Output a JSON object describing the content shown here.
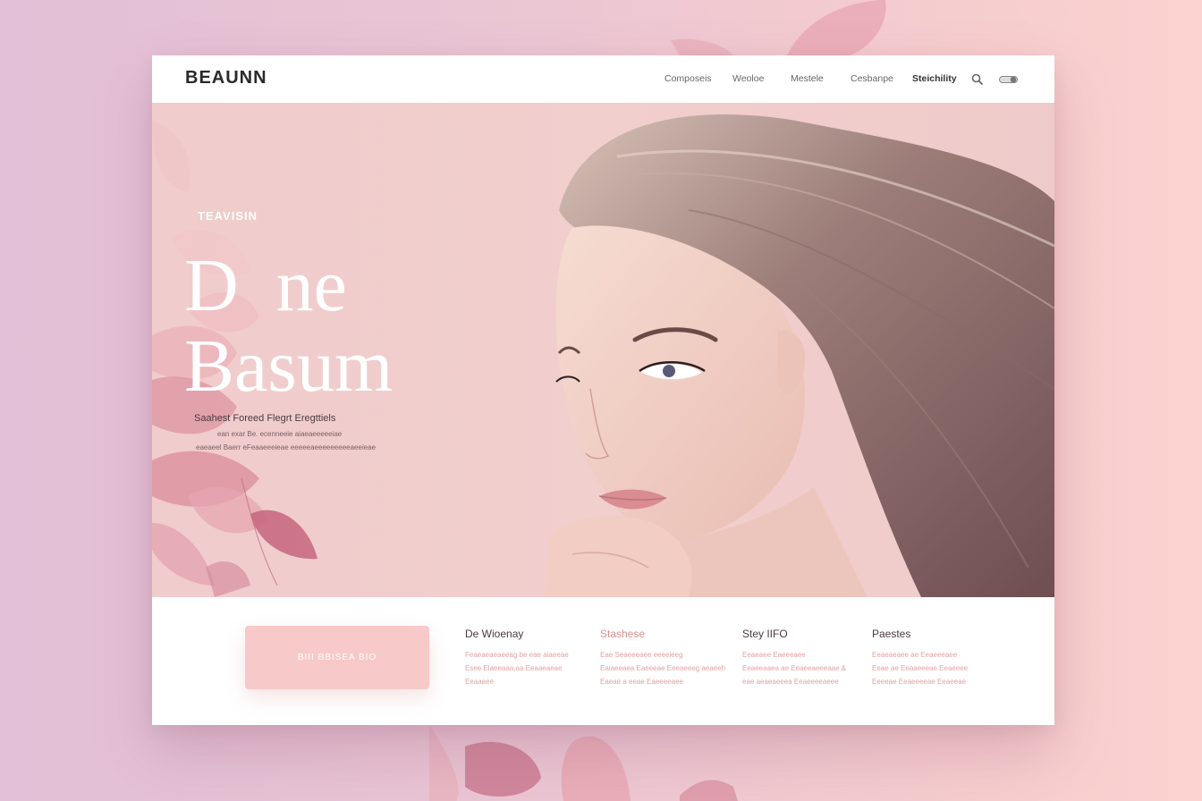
{
  "header": {
    "brand": "BEAUNN",
    "nav": [
      "Composeis",
      "Weoloe",
      "Mestele",
      "Cesbanpe",
      "Steichility"
    ],
    "active_nav": "Steichility",
    "icons": [
      "search-icon",
      "toggle-icon"
    ]
  },
  "hero": {
    "eyebrow": "TEAVISIN",
    "headline": "D  ne\nBasum",
    "subtitle": "Saahest Foreed Flegrt Eregttiels",
    "lines": [
      "ean exar Be. ecenneeie aiaeaeeeeeiae",
      "eaeaeel Baerr eFeaaeeeieae eeeeeaeeeeeeeeeaeeieae"
    ]
  },
  "cta": {
    "label": "BIII BBISEA BIO"
  },
  "columns": [
    {
      "title": "De Wioenay",
      "lines": [
        "Feaeaeaeaeeag be eae aiaeeae",
        "Esee Elaeeaaa,aa Eeaaeaeae",
        "Eeaaaee"
      ]
    },
    {
      "title": "Stashese",
      "lines": [
        "Eae Seaeeeaee eeeeieeg",
        "Eaiaeeaea Eaeeeae Eeeaeeeg aeaeeh",
        "Eaeae a eeae Eaeeeeaee"
      ]
    },
    {
      "title": "Stey IIFO",
      "lines": [
        "Eeaeaee Eaeeeaee",
        "Eeaeeaaea ae Eeaeeaeeeaae &",
        "eae aeaeaeeea Eeaeeeeaeee"
      ]
    },
    {
      "title": "Paestes",
      "lines": [
        "Eeaeaeaee ae Eeaeeeaee",
        "Eeae ae Eeaaeeeae Eeaeeee",
        "Eeeeae Eeaeeeeae Eeaeeae"
      ]
    }
  ],
  "colors": {
    "page_bg": "#ebc6d3",
    "hero_bg": "#f0cbcb",
    "cta_bg": "#f7c9c8",
    "accent_pink": "#d98e8e"
  }
}
